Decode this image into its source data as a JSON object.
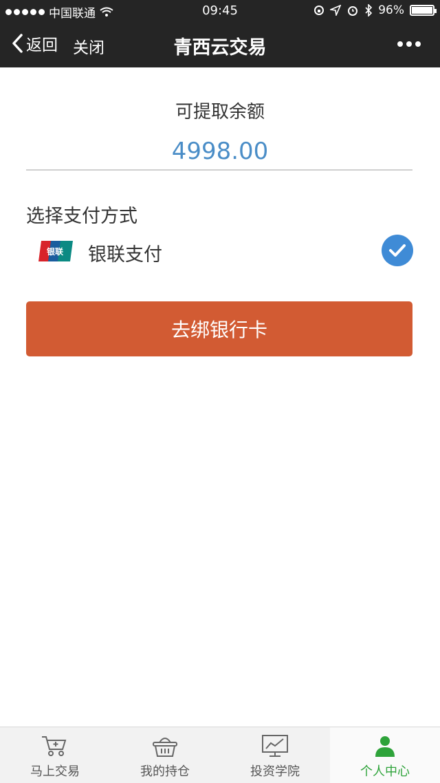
{
  "status_bar": {
    "carrier": "中国联通",
    "time": "09:45",
    "battery": "96%"
  },
  "navbar": {
    "back_label": "返回",
    "close_label": "关闭",
    "title": "青西云交易"
  },
  "balance": {
    "label": "可提取余额",
    "value": "4998.00"
  },
  "payment": {
    "section_label": "选择支付方式",
    "method_name": "银联支付",
    "logo_text": "银联",
    "selected": true
  },
  "bind_button_label": "去绑银行卡",
  "tabbar": {
    "items": [
      {
        "label": "马上交易",
        "icon": "cart-icon"
      },
      {
        "label": "我的持仓",
        "icon": "basket-icon"
      },
      {
        "label": "投资学院",
        "icon": "chart-board-icon"
      },
      {
        "label": "个人中心",
        "icon": "person-icon",
        "active": true
      }
    ]
  },
  "colors": {
    "header_bg": "#252525",
    "accent_blue": "#4a8dc7",
    "button_orange": "#d25b33",
    "active_tab_green": "#2ea33a"
  }
}
